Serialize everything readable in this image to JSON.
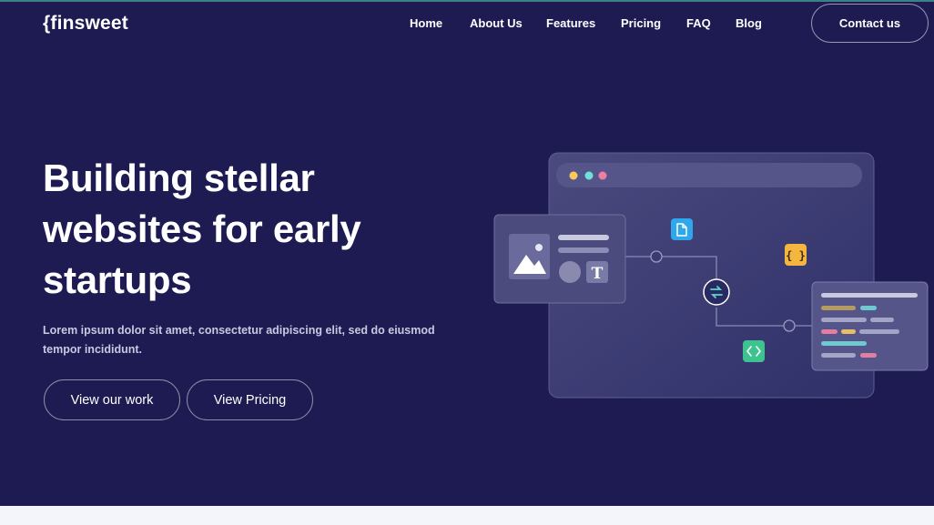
{
  "header": {
    "logo": "{finsweet",
    "nav": [
      {
        "label": "Home"
      },
      {
        "label": "About Us"
      },
      {
        "label": "Features"
      },
      {
        "label": "Pricing"
      },
      {
        "label": "FAQ"
      },
      {
        "label": "Blog"
      }
    ],
    "contact_label": "Contact us"
  },
  "hero": {
    "title_lines": [
      "Building stellar",
      "websites for early",
      "startups"
    ],
    "description": "Lorem ipsum dolor sit amet, consectetur adipiscing elit, sed do eiusmod tempor incididunt.",
    "primary_button": "View our work",
    "secondary_button": "View Pricing"
  },
  "illustration": {
    "window_dots": [
      "#f6c95d",
      "#6fe0d8",
      "#f07ea0"
    ],
    "curly_badge_text": "{ }",
    "text_tile_glyph": "T",
    "colors": {
      "file_badge": "#2ea7ec",
      "curly_badge": "#f4b63e",
      "code_badge": "#3ec28f",
      "window_bg": "#3b3a6e",
      "card_bg": "#4a4a7c"
    }
  },
  "colors": {
    "hero_bg": "#1d1b52",
    "page_bg": "#f4f5fa",
    "text_primary": "#ffffff"
  }
}
